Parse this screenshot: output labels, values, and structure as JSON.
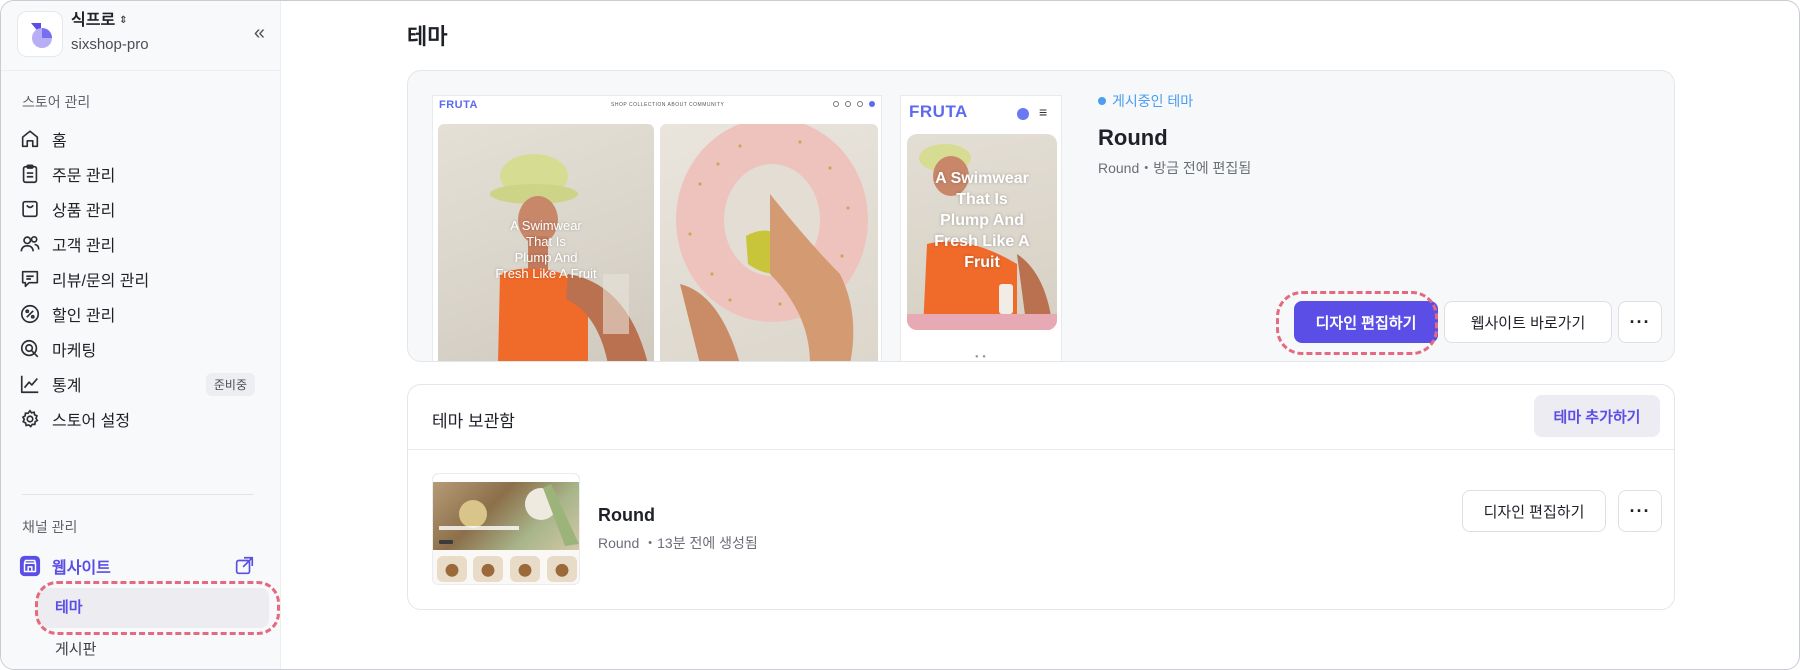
{
  "store": {
    "name": "식프로",
    "switch_glyph": "⇕",
    "id": "sixshop-pro",
    "collapse_glyph": "«"
  },
  "sidebar": {
    "store_section_label": "스토어 관리",
    "items": [
      {
        "label": "홈",
        "icon": "home-icon"
      },
      {
        "label": "주문 관리",
        "icon": "clipboard-icon"
      },
      {
        "label": "상품 관리",
        "icon": "bag-icon"
      },
      {
        "label": "고객 관리",
        "icon": "users-icon"
      },
      {
        "label": "리뷰/문의 관리",
        "icon": "message-icon"
      },
      {
        "label": "할인 관리",
        "icon": "percent-icon"
      },
      {
        "label": "마케팅",
        "icon": "target-icon"
      },
      {
        "label": "통계",
        "icon": "chart-icon",
        "badge": "준비중"
      },
      {
        "label": "스토어 설정",
        "icon": "gear-icon"
      }
    ],
    "channel_section_label": "채널 관리",
    "website": {
      "label": "웹사이트",
      "icon": "storefront-icon"
    },
    "sub_items": [
      {
        "label": "테마",
        "active": true
      },
      {
        "label": "게시판",
        "active": false
      }
    ]
  },
  "main": {
    "title": "테마",
    "current_theme": {
      "status": "게시중인 테마",
      "name": "Round",
      "meta": "Round・방금 전에 편집됨",
      "preview": {
        "desktop_logo": "FRUTA",
        "desktop_menu": "SHOP   COLLECTION   ABOUT   COMMUNITY",
        "desktop_overlay": [
          "A Swimwear",
          "That Is",
          "Plump And",
          "Fresh Like A Fruit"
        ],
        "mobile_logo": "FRUTA",
        "mobile_overlay": [
          "A Swimwear",
          "That Is",
          "Plump And",
          "Fresh Like A",
          "Fruit"
        ],
        "mobile_pager": "● ●"
      },
      "edit_label": "디자인 편집하기",
      "visit_label": "웹사이트 바로가기",
      "more_label": "···"
    },
    "library": {
      "title": "테마 보관함",
      "add_label": "테마 추가하기",
      "items": [
        {
          "name": "Round",
          "meta": "Round ・13분 전에 생성됨",
          "edit_label": "디자인 편집하기",
          "more_label": "···"
        }
      ]
    }
  },
  "colors": {
    "accent": "#5b4ee6",
    "live": "#4a9df0",
    "highlight_ring": "#e36a80",
    "fruta": "#5b6bf0"
  }
}
